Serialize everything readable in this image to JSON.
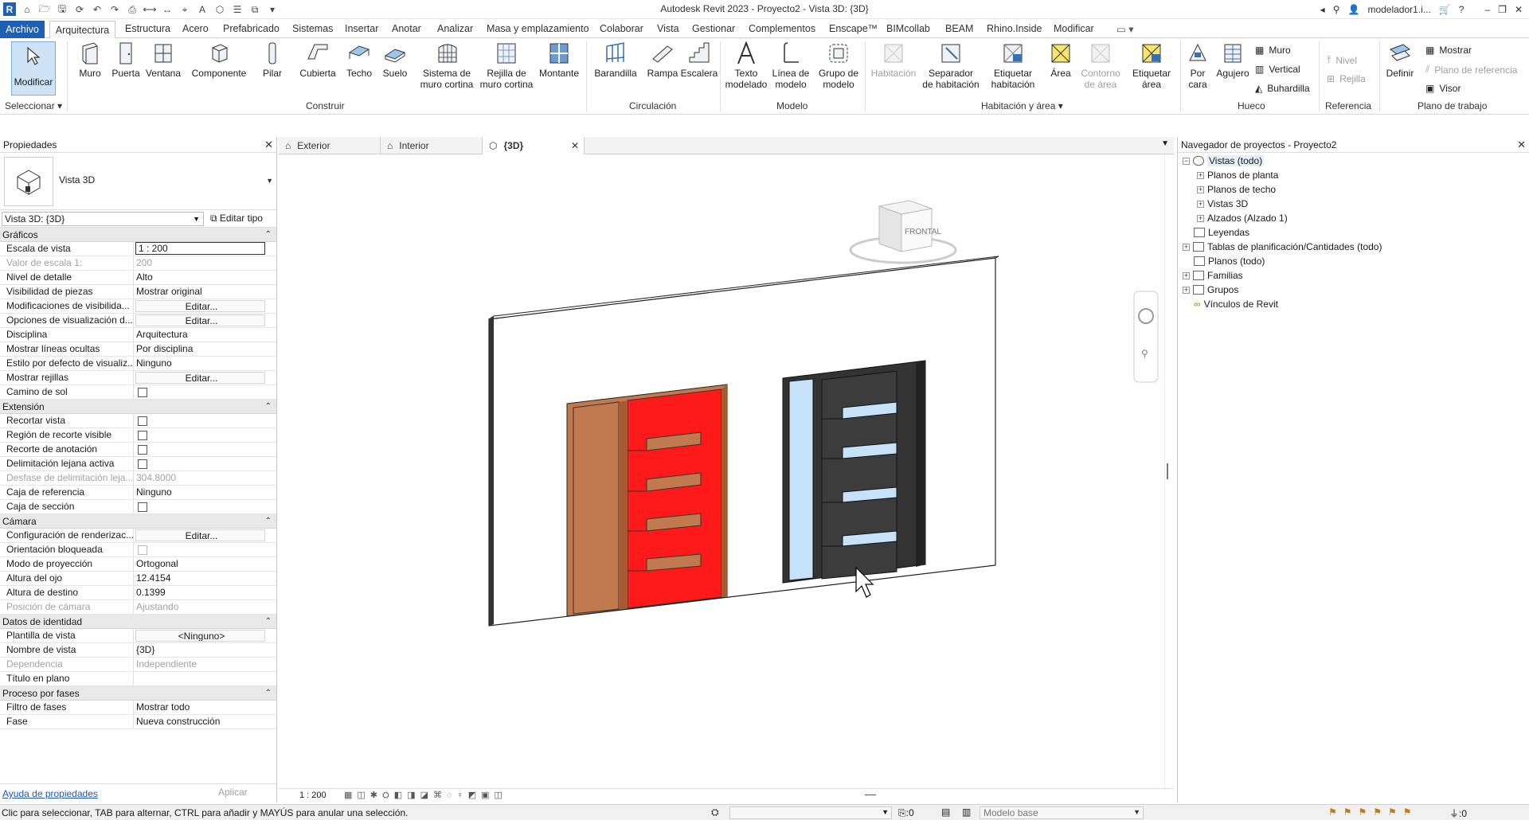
{
  "app": {
    "title": "Autodesk Revit 2023 - Proyecto2 - Vista 3D: {3D}",
    "user": "modelador1.i...",
    "logo": "R"
  },
  "menu": {
    "tabs": [
      "Archivo",
      "Arquitectura",
      "Estructura",
      "Acero",
      "Prefabricado",
      "Sistemas",
      "Insertar",
      "Anotar",
      "Analizar",
      "Masa y emplazamiento",
      "Colaborar",
      "Vista",
      "Gestionar",
      "Complementos",
      "Enscape™",
      "BIMcollab",
      "BEAM",
      "Rhino.Inside",
      "Modificar"
    ]
  },
  "ribbon": {
    "modificar": "Modificar",
    "seleccionar": "Seleccionar",
    "construir": {
      "label": "Construir",
      "items": [
        "Muro",
        "Puerta",
        "Ventana",
        "Componente",
        "Pilar",
        "Cubierta",
        "Techo",
        "Suelo"
      ],
      "sistema": [
        "Sistema de",
        "muro cortina"
      ],
      "rejilla": [
        "Rejilla de",
        "muro cortina"
      ],
      "montante": "Montante"
    },
    "circulacion": {
      "label": "Circulación",
      "items": [
        "Barandilla",
        "Rampa",
        "Escalera"
      ]
    },
    "modelo": {
      "label": "Modelo",
      "texto": [
        "Texto",
        "modelado"
      ],
      "linea": [
        "Línea de",
        "modelo"
      ],
      "grupo": [
        "Grupo de",
        "modelo"
      ]
    },
    "habitacion": {
      "label": "Habitación y área",
      "habitacion": "Habitación",
      "separador": [
        "Separador",
        "de habitación"
      ],
      "etiquetar_hab": [
        "Etiquetar",
        "habitación"
      ],
      "area": "Área",
      "contorno": [
        "Contorno",
        "de área"
      ],
      "etiquetar_area": [
        "Etiquetar",
        "área"
      ]
    },
    "hueco": {
      "label": "Hueco",
      "porcara": [
        "Por",
        "cara"
      ],
      "agujero": "Agujero",
      "muro": "Muro",
      "vertical": "Vertical",
      "buhardilla": "Buhardilla"
    },
    "referencia": {
      "label": "Referencia",
      "nivel": "Nivel",
      "rejilla": "Rejilla"
    },
    "plano": {
      "label": "Plano de trabajo",
      "definir": "Definir",
      "mostrar": "Mostrar",
      "plano_ref": "Plano de referencia",
      "visor": "Visor"
    }
  },
  "properties": {
    "title": "Propiedades",
    "type_name": "Vista 3D",
    "instance": "Vista 3D: {3D}",
    "edit_type": "Editar tipo",
    "help": "Ayuda de propiedades",
    "apply": "Aplicar",
    "sections": [
      {
        "name": "Gráficos",
        "rows": [
          {
            "k": "Escala de vista",
            "v": "1 : 200",
            "style": "boxed"
          },
          {
            "k": "Valor de escala    1:",
            "v": "200",
            "style": "dis"
          },
          {
            "k": "Nivel de detalle",
            "v": "Alto"
          },
          {
            "k": "Visibilidad de piezas",
            "v": "Mostrar original"
          },
          {
            "k": "Modificaciones de visibilida...",
            "v": "Editar...",
            "style": "btn"
          },
          {
            "k": "Opciones de visualización d...",
            "v": "Editar...",
            "style": "btn"
          },
          {
            "k": "Disciplina",
            "v": "Arquitectura"
          },
          {
            "k": "Mostrar líneas ocultas",
            "v": "Por disciplina"
          },
          {
            "k": "Estilo por defecto de visualiz...",
            "v": "Ninguno"
          },
          {
            "k": "Mostrar rejillas",
            "v": "Editar...",
            "style": "btn"
          },
          {
            "k": "Camino de sol",
            "v": "",
            "style": "chk"
          }
        ]
      },
      {
        "name": "Extensión",
        "rows": [
          {
            "k": "Recortar vista",
            "v": "",
            "style": "chk"
          },
          {
            "k": "Región de recorte visible",
            "v": "",
            "style": "chk"
          },
          {
            "k": "Recorte de anotación",
            "v": "",
            "style": "chk"
          },
          {
            "k": "Delimitación lejana activa",
            "v": "",
            "style": "chk"
          },
          {
            "k": "Desfase de delimitación leja...",
            "v": "304.8000",
            "style": "dis"
          },
          {
            "k": "Caja de referencia",
            "v": "Ninguno"
          },
          {
            "k": "Caja de sección",
            "v": "",
            "style": "chk"
          }
        ]
      },
      {
        "name": "Cámara",
        "rows": [
          {
            "k": "Configuración de renderizac...",
            "v": "Editar...",
            "style": "btn"
          },
          {
            "k": "Orientación bloqueada",
            "v": "",
            "style": "chkdis"
          },
          {
            "k": "Modo de proyección",
            "v": "Ortogonal"
          },
          {
            "k": "Altura del ojo",
            "v": "12.4154"
          },
          {
            "k": "Altura de destino",
            "v": "0.1399"
          },
          {
            "k": "Posición de cámara",
            "v": "Ajustando",
            "style": "dis"
          }
        ]
      },
      {
        "name": "Datos de identidad",
        "rows": [
          {
            "k": "Plantilla de vista",
            "v": "<Ninguno>",
            "style": "btn"
          },
          {
            "k": "Nombre de vista",
            "v": "{3D}"
          },
          {
            "k": "Dependencia",
            "v": "Independiente",
            "style": "dis"
          },
          {
            "k": "Título en plano",
            "v": ""
          }
        ]
      },
      {
        "name": "Proceso por fases",
        "rows": [
          {
            "k": "Filtro de fases",
            "v": "Mostrar todo"
          },
          {
            "k": "Fase",
            "v": "Nueva construcción"
          }
        ]
      }
    ]
  },
  "views": {
    "tabs": [
      "Exterior",
      "Interior",
      "{3D}"
    ],
    "active": "{3D}",
    "scale": "1 : 200",
    "cube_label": "FRONTAL"
  },
  "browser": {
    "title": "Navegador de proyectos - Proyecto2",
    "nodes": [
      "Vistas (todo)",
      "Planos de planta",
      "Planos de techo",
      "Vistas 3D",
      "Alzados (Alzado 1)",
      "Leyendas",
      "Tablas de planificación/Cantidades (todo)",
      "Planos (todo)",
      "Familias",
      "Grupos",
      "Vínculos de Revit"
    ]
  },
  "status": {
    "message": "Clic para seleccionar, TAB para alternar, CTRL para añadir y MAYÚS para anular una selección.",
    "counter": ":0",
    "model": "Modelo base",
    "filter": ":0"
  },
  "colors": {
    "accent": "#1f5fb5",
    "door_wood": "#c07a4e",
    "door_red": "#ff1a1a",
    "door_dark": "#333333",
    "glass": "#c6e2f8"
  }
}
